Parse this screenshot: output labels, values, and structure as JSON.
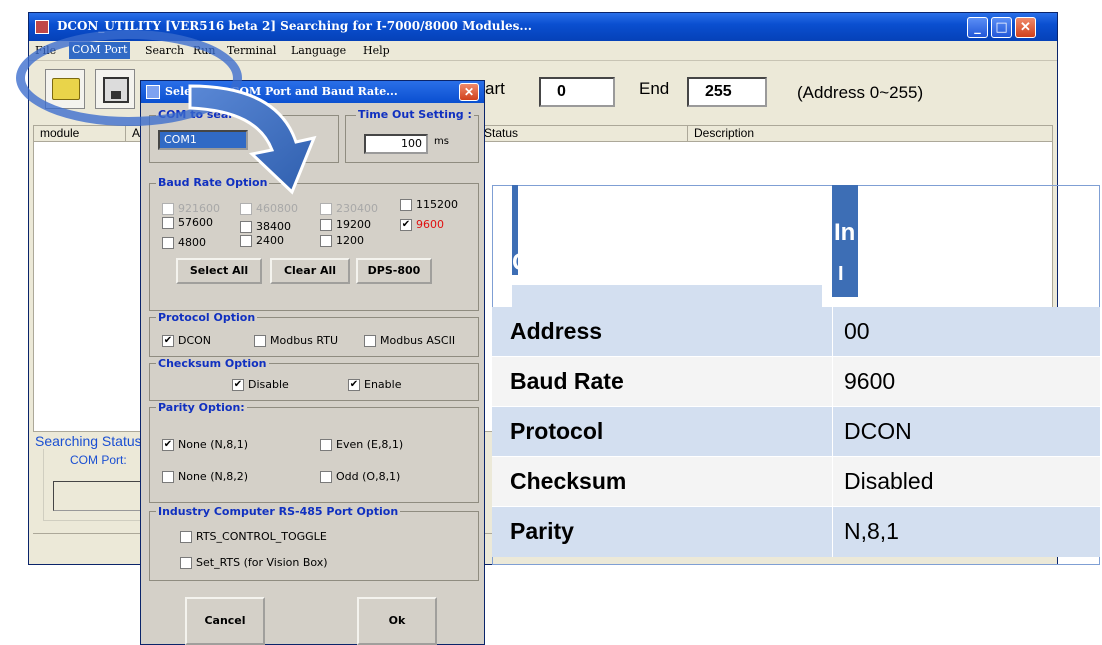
{
  "window": {
    "title": "DCON_UTILITY [VER516 beta 2] Searching for I-7000/8000 Modules...",
    "controls": [
      "_",
      "□",
      "✕"
    ]
  },
  "menu": [
    "File",
    "COM Port",
    "Search",
    "Run",
    "Terminal",
    "Language",
    "Help"
  ],
  "toolbar": {
    "start_label": "Start",
    "start_value": "0",
    "end_label": "End",
    "end_value": "255",
    "address_hint": "(Address 0~255)"
  },
  "list": {
    "columns": [
      "module",
      "A",
      "Status",
      "Description"
    ]
  },
  "status_group": {
    "title": "Searching Status",
    "com_port_label": "COM Port:"
  },
  "dialog": {
    "title": "Select the COM Port and Baud Rate...",
    "com_group_label": "COM to search",
    "com_value": "COM1",
    "timeout_group_label": "Time Out Setting :",
    "timeout_value": "100",
    "timeout_unit": "ms",
    "baud_group_label": "Baud Rate Option",
    "baud_rates": [
      {
        "label": "921600",
        "checked": false,
        "disabled": true
      },
      {
        "label": "460800",
        "checked": false,
        "disabled": true
      },
      {
        "label": "230400",
        "checked": false,
        "disabled": true
      },
      {
        "label": "115200",
        "checked": false,
        "disabled": false
      },
      {
        "label": "57600",
        "checked": false,
        "disabled": false
      },
      {
        "label": "38400",
        "checked": false,
        "disabled": false
      },
      {
        "label": "19200",
        "checked": false,
        "disabled": false
      },
      {
        "label": "9600",
        "checked": true,
        "disabled": false
      },
      {
        "label": "4800",
        "checked": false,
        "disabled": false
      },
      {
        "label": "2400",
        "checked": false,
        "disabled": false
      },
      {
        "label": "1200",
        "checked": false,
        "disabled": false
      }
    ],
    "select_all": "Select All",
    "clear_all": "Clear All",
    "dps800": "DPS-800",
    "protocol_group_label": "Protocol Option",
    "protocols": [
      {
        "label": "DCON",
        "checked": true
      },
      {
        "label": "Modbus RTU",
        "checked": false
      },
      {
        "label": "Modbus ASCII",
        "checked": false
      }
    ],
    "checksum_group_label": "Checksum  Option",
    "checksums": [
      {
        "label": "Disable",
        "checked": true
      },
      {
        "label": "Enable",
        "checked": true
      }
    ],
    "parity_group_label": "Parity Option:",
    "parities": [
      {
        "label": "None  (N,8,1)",
        "checked": true
      },
      {
        "label": "Even  (E,8,1)",
        "checked": false
      },
      {
        "label": "None (N,8,2)",
        "checked": false
      },
      {
        "label": "Odd  (O,8,1)",
        "checked": false
      }
    ],
    "rs485_group_label": "Industry Computer RS-485 Port Option",
    "rs485_options": [
      {
        "label": "RTS_CONTROL_TOGGLE",
        "checked": false
      },
      {
        "label": "Set_RTS (for Vision Box)",
        "checked": false
      }
    ],
    "cancel": "Cancel",
    "ok": "Ok"
  },
  "param_table": {
    "header_left": "COM parameter",
    "header_right": "In",
    "header_right_line2": "I",
    "rows": [
      {
        "key": "Address",
        "value": "00"
      },
      {
        "key": "Baud Rate",
        "value": "9600"
      },
      {
        "key": "Protocol",
        "value": "DCON"
      },
      {
        "key": "Checksum",
        "value": "Disabled"
      },
      {
        "key": "Parity",
        "value": "N,8,1"
      }
    ],
    "colors": {
      "header": "#3d6eb5",
      "row_a": "#d3dff0",
      "row_b": "#f4f4f4"
    }
  }
}
